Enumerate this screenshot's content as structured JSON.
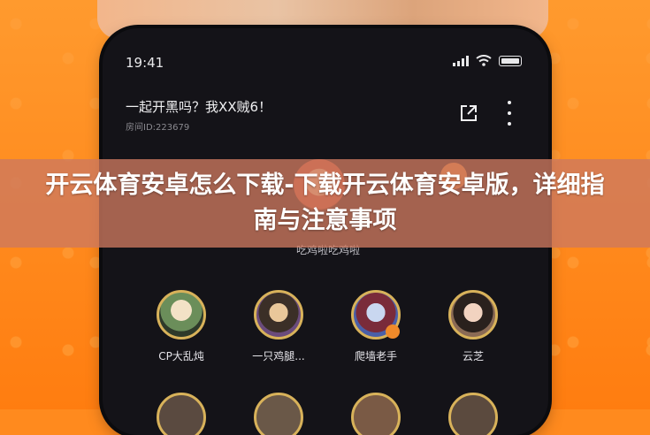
{
  "status": {
    "time": "19:41"
  },
  "room": {
    "title": "一起开黑吗？我XX贼6！",
    "id_text": "房间ID:223679",
    "host_name": "吃鸡啦吃鸡啦"
  },
  "seats": [
    {
      "name": "CP大乱炖"
    },
    {
      "name": "一只鸡腿..."
    },
    {
      "name": "爬墙老手"
    },
    {
      "name": "云芝"
    }
  ],
  "banner": {
    "title": "开云体育安卓怎么下载-下载开云体育安卓版，详细指南与注意事项"
  },
  "colors": {
    "background": "#ff8a1e",
    "phone": "#141318",
    "seat_ring": "#d8b25a",
    "banner": "#cd785f"
  },
  "icons": [
    "signal-icon",
    "wifi-icon",
    "battery-icon",
    "share-icon",
    "more-icon"
  ]
}
